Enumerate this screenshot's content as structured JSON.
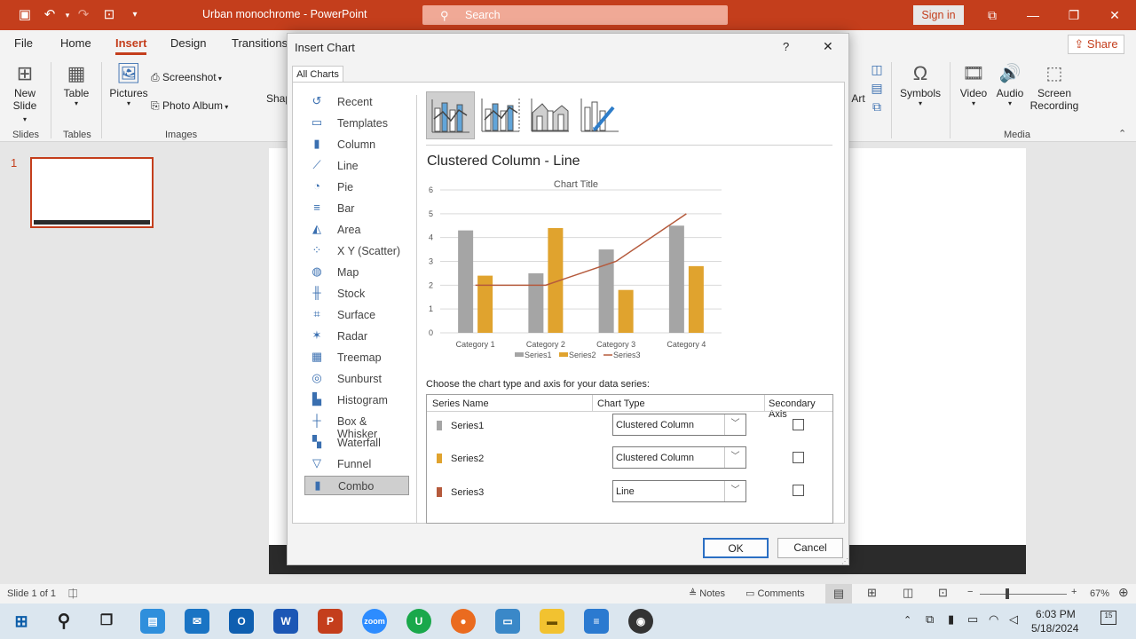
{
  "window": {
    "doc_title": "Urban monochrome  -  PowerPoint",
    "search_placeholder": "Search",
    "sign_in": "Sign in"
  },
  "ribbon_tabs": [
    "File",
    "Home",
    "Insert",
    "Design",
    "Transitions"
  ],
  "share_label": "Share",
  "ribbon": {
    "new_slide": "New",
    "new_slide2": "Slide",
    "table": "Table",
    "pictures": "Pictures",
    "screenshot": "Screenshot",
    "photo_album": "Photo Album",
    "shapes_partial": "Shap",
    "art_partial": "Art",
    "symbols": "Symbols",
    "video": "Video",
    "audio": "Audio",
    "screen": "Screen",
    "recording": "Recording",
    "groups": {
      "slides": "Slides",
      "tables": "Tables",
      "images": "Images",
      "media": "Media"
    }
  },
  "thumb_number": "1",
  "status": {
    "slide": "Slide 1 of 1",
    "notes": "Notes",
    "comments": "Comments",
    "zoom": "67%"
  },
  "taskbar": {
    "time": "6:03 PM",
    "date": "5/18/2024",
    "notif": "15"
  },
  "dialog": {
    "title": "Insert Chart",
    "help": "?",
    "close": "✕",
    "tab": "All Charts",
    "chart_types": [
      "Recent",
      "Templates",
      "Column",
      "Line",
      "Pie",
      "Bar",
      "Area",
      "X Y (Scatter)",
      "Map",
      "Stock",
      "Surface",
      "Radar",
      "Treemap",
      "Sunburst",
      "Histogram",
      "Box & Whisker",
      "Waterfall",
      "Funnel",
      "Combo"
    ],
    "selected_type": "Combo",
    "subtype_title": "Clustered Column - Line",
    "prompt": "Choose the chart type and axis for your data series:",
    "grid_headers": {
      "series": "Series Name",
      "type": "Chart Type",
      "axis": "Secondary Axis"
    },
    "series_rows": [
      {
        "name": "Series1",
        "type": "Clustered Column",
        "color": "#a5a5a5"
      },
      {
        "name": "Series2",
        "type": "Clustered Column",
        "color": "#e0a32e"
      },
      {
        "name": "Series3",
        "type": "Line",
        "color": "#b55a3c"
      }
    ],
    "ok": "OK",
    "cancel": "Cancel"
  },
  "chart_data": {
    "type": "bar",
    "title": "Chart Title",
    "categories": [
      "Category 1",
      "Category 2",
      "Category 3",
      "Category 4"
    ],
    "series": [
      {
        "name": "Series1",
        "type": "bar",
        "color": "#a5a5a5",
        "values": [
          4.3,
          2.5,
          3.5,
          4.5
        ]
      },
      {
        "name": "Series2",
        "type": "bar",
        "color": "#e0a32e",
        "values": [
          2.4,
          4.4,
          1.8,
          2.8
        ]
      },
      {
        "name": "Series3",
        "type": "line",
        "color": "#b55a3c",
        "values": [
          2,
          2,
          3,
          5
        ]
      }
    ],
    "yticks": [
      "0",
      "1",
      "2",
      "3",
      "4",
      "5",
      "6"
    ],
    "ylim": [
      0,
      6
    ],
    "grid": true,
    "legend": "bottom"
  }
}
